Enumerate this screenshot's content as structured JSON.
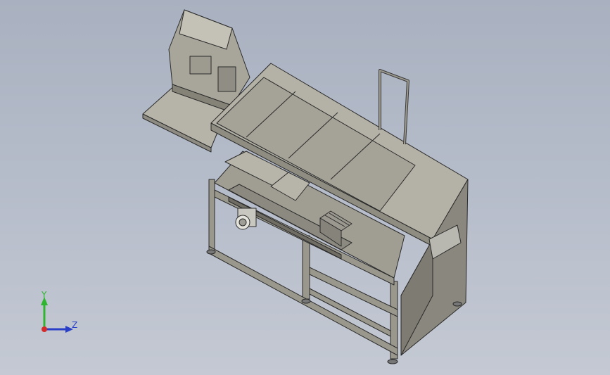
{
  "viewport": {
    "background_top": "#a9b1c0",
    "background_bottom": "#c4c9d3",
    "model": {
      "description_icon": "machine-assembly-icon",
      "face_color": "#aaa89c",
      "edge_color": "#2a2a2a"
    }
  },
  "triad": {
    "y_label": "Y",
    "z_label": "Z",
    "y_color": "#2fb52f",
    "z_color": "#2a3fc8",
    "origin_color": "#d42a2a"
  }
}
